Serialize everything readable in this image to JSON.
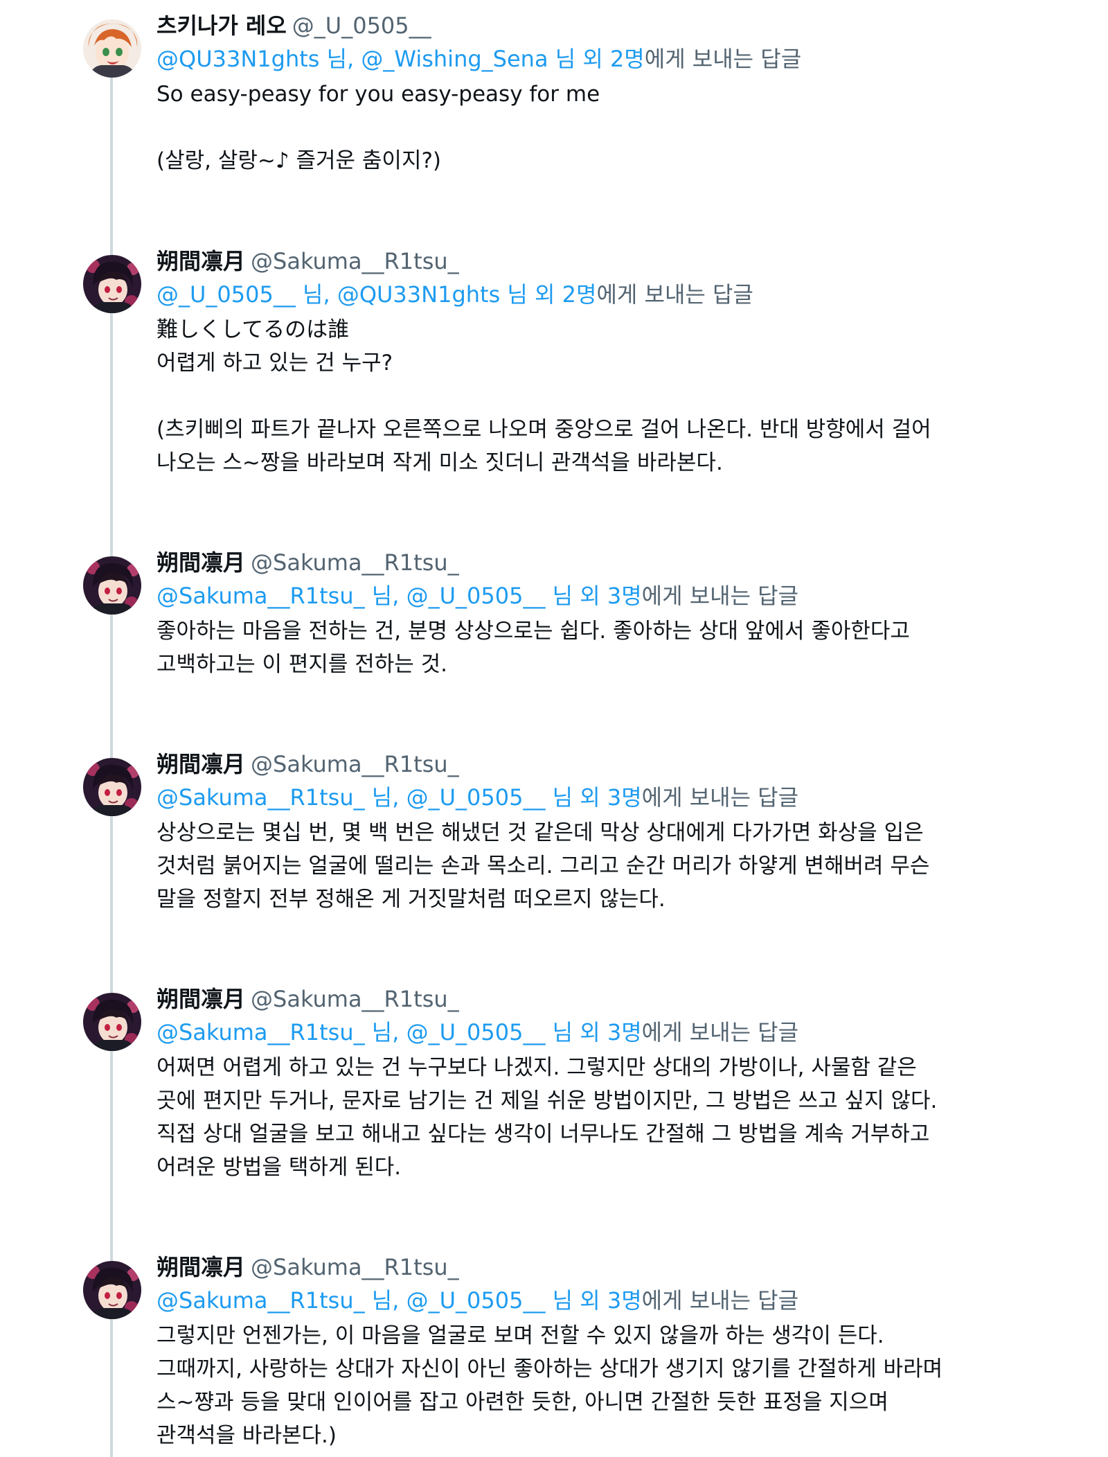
{
  "colors": {
    "accent": "#1d9bf0",
    "secondary_text": "#536471",
    "thread_line": "#cfd9de"
  },
  "tweets": [
    {
      "avatar_icon": "leo-avatar",
      "name": "츠키나가 레오",
      "handle": "@_U_0505__",
      "reply_mentions": "@QU33N1ghts 님, @_Wishing_Sena 님 외 2명",
      "reply_suffix": "에게 보내는 답글",
      "lines": [
        "So easy-peasy for you easy-peasy for me",
        "",
        "(살랑, 살랑~♪ 즐거운 춤이지?)"
      ]
    },
    {
      "avatar_icon": "ritsu-avatar",
      "name": "朔間凛月",
      "handle": "@Sakuma__R1tsu_",
      "reply_mentions": "@_U_0505__ 님, @QU33N1ghts 님 외 2명",
      "reply_suffix": "에게 보내는 답글",
      "lines": [
        "難しくしてるのは誰",
        "어렵게 하고 있는 건 누구?",
        "",
        "(츠키삐의 파트가 끝나자 오른쪽으로 나오며 중앙으로 걸어 나온다. 반대 방향에서 걸어",
        "나오는 스~짱을 바라보며 작게 미소 짓더니 관객석을 바라본다."
      ]
    },
    {
      "avatar_icon": "ritsu-avatar",
      "name": "朔間凛月",
      "handle": "@Sakuma__R1tsu_",
      "reply_mentions": "@Sakuma__R1tsu_ 님, @_U_0505__ 님 외 3명",
      "reply_suffix": "에게 보내는 답글",
      "lines": [
        "좋아하는 마음을 전하는 건, 분명 상상으로는 쉽다. 좋아하는 상대 앞에서 좋아한다고",
        "고백하고는 이 편지를 전하는 것."
      ]
    },
    {
      "avatar_icon": "ritsu-avatar",
      "name": "朔間凛月",
      "handle": "@Sakuma__R1tsu_",
      "reply_mentions": "@Sakuma__R1tsu_ 님, @_U_0505__ 님 외 3명",
      "reply_suffix": "에게 보내는 답글",
      "lines": [
        "상상으로는 몇십 번, 몇 백 번은 해냈던 것 같은데 막상 상대에게 다가가면 화상을 입은",
        "것처럼 붉어지는 얼굴에 떨리는 손과 목소리. 그리고 순간 머리가 하얗게 변해버려 무슨",
        "말을 정할지 전부 정해온 게 거짓말처럼 떠오르지 않는다."
      ]
    },
    {
      "avatar_icon": "ritsu-avatar",
      "name": "朔間凛月",
      "handle": "@Sakuma__R1tsu_",
      "reply_mentions": "@Sakuma__R1tsu_ 님, @_U_0505__ 님 외 3명",
      "reply_suffix": "에게 보내는 답글",
      "lines": [
        "어쩌면 어렵게 하고 있는 건 누구보다 나겠지. 그렇지만 상대의 가방이나, 사물함 같은",
        "곳에 편지만 두거나, 문자로 남기는 건 제일 쉬운 방법이지만, 그 방법은 쓰고 싶지 않다.",
        "직접 상대 얼굴을 보고 해내고 싶다는 생각이 너무나도 간절해 그 방법을 계속 거부하고",
        "어려운 방법을 택하게 된다."
      ]
    },
    {
      "avatar_icon": "ritsu-avatar",
      "name": "朔間凛月",
      "handle": "@Sakuma__R1tsu_",
      "reply_mentions": "@Sakuma__R1tsu_ 님, @_U_0505__ 님 외 3명",
      "reply_suffix": "에게 보내는 답글",
      "lines": [
        "그렇지만 언젠가는, 이 마음을 얼굴로 보며 전할 수 있지 않을까 하는 생각이 든다.",
        "그때까지, 사랑하는 상대가 자신이 아닌 좋아하는 상대가 생기지 않기를 간절하게 바라며",
        "스~쨩과 등을 맞대 인이어를 잡고 아련한 듯한, 아니면 간절한 듯한 표정을 지으며",
        "관객석을 바라본다.)"
      ]
    }
  ]
}
